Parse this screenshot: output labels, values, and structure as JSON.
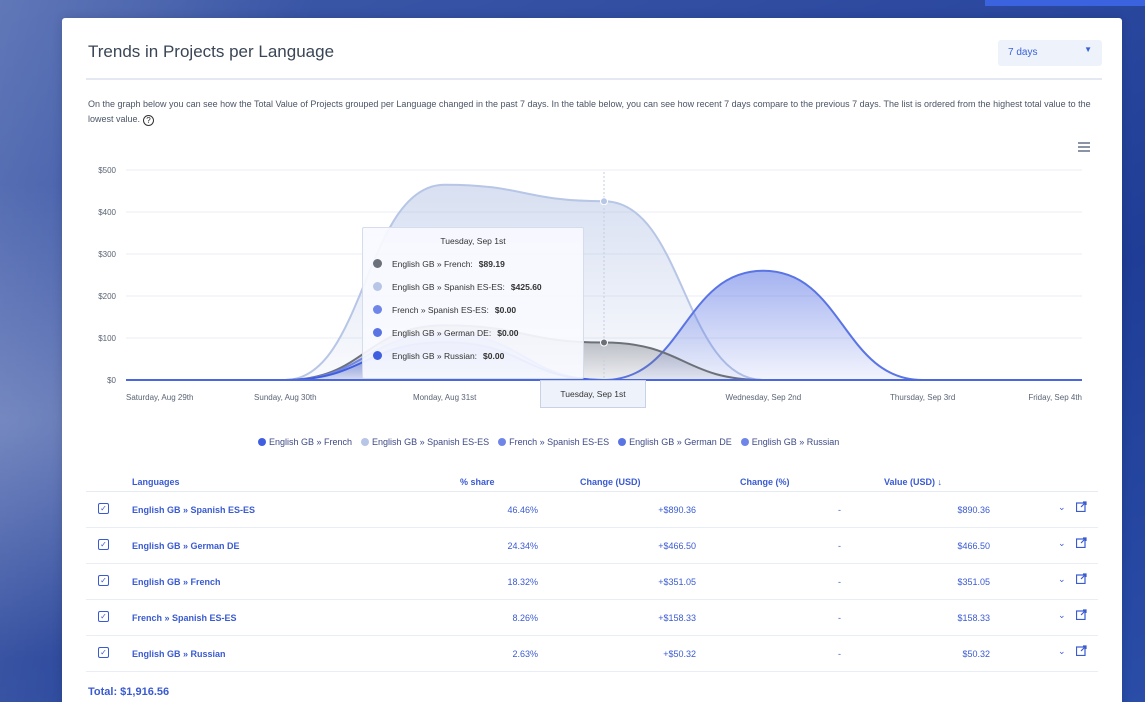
{
  "panel": {
    "title": "Trends in Projects per Language",
    "period_select": "7 days",
    "description": "On the graph below you can see how the Total Value of Projects grouped per Language changed in the past 7 days. In the table below, you can see how recent 7 days compare to the previous 7 days. The list is ordered from the highest total value to the lowest value.",
    "help_icon": "question-circle-icon",
    "menu_icon": "hamburger-icon"
  },
  "chart_data": {
    "type": "area",
    "x": [
      "Saturday, Aug 29th",
      "Sunday, Aug 30th",
      "Monday, Aug 31st",
      "Tuesday, Sep 1st",
      "Wednesday, Sep 2nd",
      "Thursday, Sep 3rd",
      "Friday, Sep 4th"
    ],
    "y_ticks": [
      "$0",
      "$100",
      "$200",
      "$300",
      "$400",
      "$500"
    ],
    "ylim": [
      0,
      500
    ],
    "grid": true,
    "series": [
      {
        "name": "English GB » French",
        "color": "#6c7079",
        "values": [
          0,
          0,
          130,
          89.19,
          0,
          0,
          0
        ]
      },
      {
        "name": "English GB » Spanish ES-ES",
        "color": "#b7c6e6",
        "values": [
          0,
          0,
          465,
          425.6,
          0,
          0,
          0
        ]
      },
      {
        "name": "French » Spanish ES-ES",
        "color": "#6f86e8",
        "values": [
          0,
          0,
          110,
          0,
          0,
          0,
          0
        ]
      },
      {
        "name": "English GB » German DE",
        "color": "#5a74e4",
        "values": [
          0,
          0,
          0,
          0,
          260,
          0,
          0
        ]
      },
      {
        "name": "English GB » Russian",
        "color": "#3f5fe0",
        "values": [
          0,
          0,
          90,
          0,
          0,
          0,
          0
        ]
      }
    ],
    "tooltip": {
      "title": "Tuesday, Sep 1st",
      "rows": [
        {
          "label": "English GB » French:",
          "value": "$89.19",
          "color": "#6c7079"
        },
        {
          "label": "English GB » Spanish ES-ES:",
          "value": "$425.60",
          "color": "#b7c6e6"
        },
        {
          "label": "French » Spanish ES-ES:",
          "value": "$0.00",
          "color": "#6f86e8"
        },
        {
          "label": "English GB » German DE:",
          "value": "$0.00",
          "color": "#5a74e4"
        },
        {
          "label": "English GB » Russian:",
          "value": "$0.00",
          "color": "#3f5fe0"
        }
      ]
    },
    "hover_label": "Tuesday, Sep 1st"
  },
  "legend": [
    {
      "label": "English GB » French",
      "color": "#3f5fe0"
    },
    {
      "label": "English GB » Spanish ES-ES",
      "color": "#b7c6e6"
    },
    {
      "label": "French » Spanish ES-ES",
      "color": "#6f86e8"
    },
    {
      "label": "English GB » German DE",
      "color": "#5a74e4"
    },
    {
      "label": "English GB » Russian",
      "color": "#6f86e8"
    }
  ],
  "table": {
    "headers": {
      "languages": "Languages",
      "share": "% share",
      "change_usd": "Change (USD)",
      "change_pct": "Change (%)",
      "value": "Value (USD)",
      "sort_icon": "arrow-down-icon"
    },
    "rows": [
      {
        "language": "English GB » Spanish ES-ES",
        "share": "46.46%",
        "change_usd": "+$890.36",
        "change_pct": "-",
        "value": "$890.36"
      },
      {
        "language": "English GB » German DE",
        "share": "24.34%",
        "change_usd": "+$466.50",
        "change_pct": "-",
        "value": "$466.50"
      },
      {
        "language": "English GB » French",
        "share": "18.32%",
        "change_usd": "+$351.05",
        "change_pct": "-",
        "value": "$351.05"
      },
      {
        "language": "French » Spanish ES-ES",
        "share": "8.26%",
        "change_usd": "+$158.33",
        "change_pct": "-",
        "value": "$158.33"
      },
      {
        "language": "English GB » Russian",
        "share": "2.63%",
        "change_usd": "+$50.32",
        "change_pct": "-",
        "value": "$50.32"
      }
    ],
    "total": "Total: $1,916.56"
  },
  "colors": {
    "accent": "#3a5bd0",
    "background": "#2d4aa0"
  }
}
